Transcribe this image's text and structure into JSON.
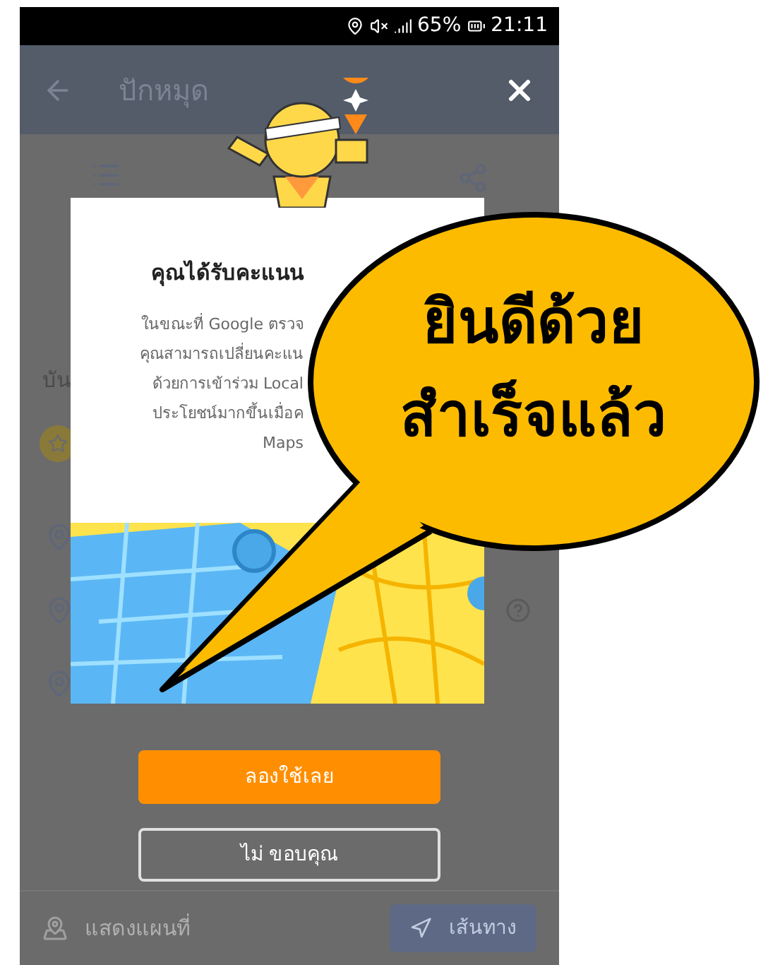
{
  "status_bar": {
    "battery": "65%",
    "time": "21:11"
  },
  "app_bar": {
    "title": "ปักหมุด"
  },
  "background": {
    "section_label": "บัน"
  },
  "dialog": {
    "title": "คุณได้รับคะแนน",
    "body_lines": [
      "ในขณะที่ Google ตรวจ",
      "คุณสามารถเปลี่ยนคะแน",
      "ด้วยการเข้าร่วม Local",
      "ประโยชน์มากขึ้นเมื่อค",
      "Maps"
    ]
  },
  "buttons": [
    {
      "label": "ลองใช้เลย",
      "kind": "primary"
    },
    {
      "label": "ไม่ ขอบคุณ",
      "kind": "outline"
    }
  ],
  "bottom_bar": {
    "map_label": "แสดงแผนที่",
    "directions_label": "เส้นทาง"
  },
  "callout": {
    "lines": [
      "ยินดีด้วย",
      "สำเร็จแล้ว"
    ]
  }
}
